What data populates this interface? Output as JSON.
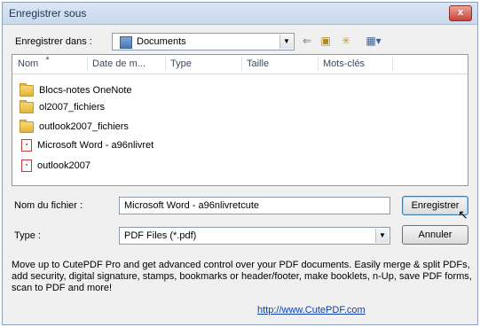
{
  "window": {
    "title": "Enregistrer sous",
    "close_label": "x"
  },
  "location": {
    "label": "Enregistrer dans :",
    "value": "Documents"
  },
  "file_list": {
    "columns": [
      "Nom",
      "Date de m...",
      "Type",
      "Taille",
      "Mots-clés"
    ],
    "items": [
      {
        "name": "Blocs-notes OneNote",
        "kind": "folder"
      },
      {
        "name": "ol2007_fichiers",
        "kind": "folder"
      },
      {
        "name": "outlook2007_fichiers",
        "kind": "folder"
      },
      {
        "name": "Microsoft Word - a96nlivret",
        "kind": "pdf"
      },
      {
        "name": "outlook2007",
        "kind": "pdf"
      }
    ]
  },
  "filename": {
    "label": "Nom du fichier :",
    "value": "Microsoft Word - a96nlivretcute"
  },
  "filetype": {
    "label": "Type :",
    "value": "PDF Files (*.pdf)"
  },
  "buttons": {
    "save": "Enregistrer",
    "cancel": "Annuler"
  },
  "promo": {
    "text": "Move up to CutePDF Pro and get advanced control over your PDF documents. Easily merge & split PDFs, add security, digital signature, stamps, bookmarks or header/footer, make booklets, n-Up, save PDF forms, scan to PDF and more!",
    "link": "http://www.CutePDF.com"
  }
}
